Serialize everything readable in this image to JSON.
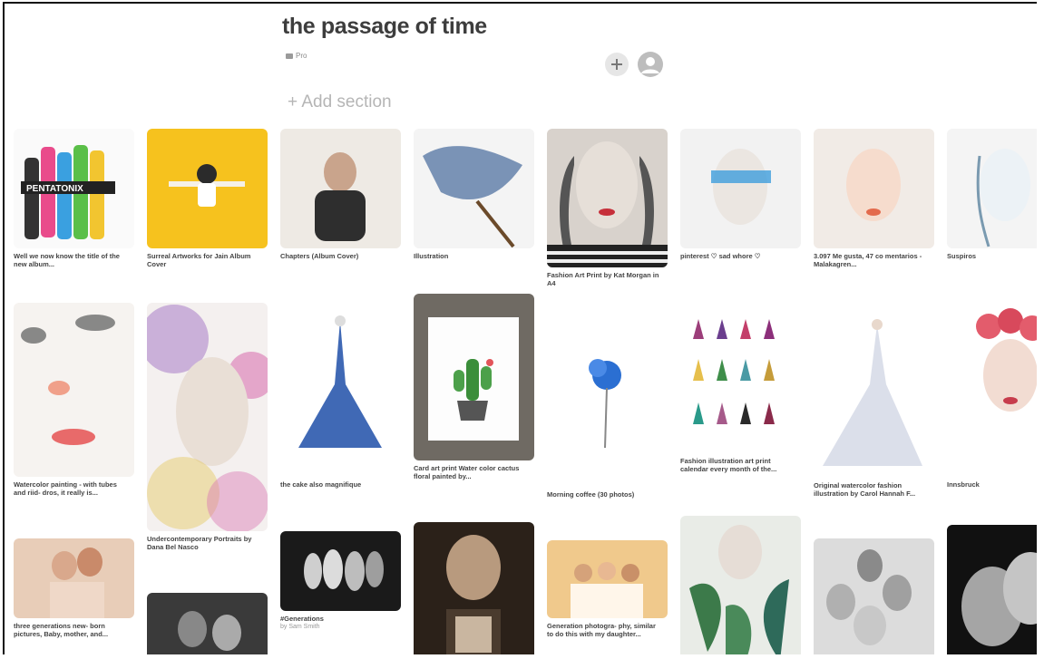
{
  "board": {
    "title": "the passage of time",
    "privacy_label": "Pro",
    "add_section_label": "+ Add section"
  },
  "icons": {
    "add": "plus-icon",
    "profile": "user-avatar-icon"
  },
  "pins": [
    {
      "id": "p1",
      "caption": "Well we now know the title of the new album..."
    },
    {
      "id": "p2",
      "caption": "Surreal Artworks for Jain Album Cover"
    },
    {
      "id": "p3",
      "caption": "Chapters (Album Cover)"
    },
    {
      "id": "p4",
      "caption": "Illustration"
    },
    {
      "id": "p5",
      "caption": "Fashion Art Print by Kat Morgan in A4"
    },
    {
      "id": "p6",
      "caption": "pinterest ♡ sad whore ♡"
    },
    {
      "id": "p7",
      "caption": "3.097 Me gusta, 47 co mentarios - Malakagren..."
    },
    {
      "id": "p8",
      "caption": "Suspiros"
    },
    {
      "id": "p9",
      "caption": "Watercolor painting - with tubes and riid- dros, it really is..."
    },
    {
      "id": "p10",
      "caption": "Undercontemporary Portraits by Dana Bel Nasco"
    },
    {
      "id": "p11",
      "caption": "the cake also magnifique"
    },
    {
      "id": "p12",
      "caption": "Card art print Water color cactus floral painted by..."
    },
    {
      "id": "p13",
      "caption": "Morning coffee (30 photos)"
    },
    {
      "id": "p14",
      "caption": "Fashion illustration art print calendar every month of the..."
    },
    {
      "id": "p15",
      "caption": "Original watercolor fashion illustration by Carol Hannah F..."
    },
    {
      "id": "p16",
      "caption": "Innsbruck"
    },
    {
      "id": "p17",
      "caption": "three generations new- born pictures, Baby, mother, and..."
    },
    {
      "id": "p18",
      "caption": "#Generations",
      "subcaption": "by Sam Smith"
    },
    {
      "id": "p19",
      "caption": "Generation photogra- phy, similar to do this with my daughter..."
    }
  ]
}
